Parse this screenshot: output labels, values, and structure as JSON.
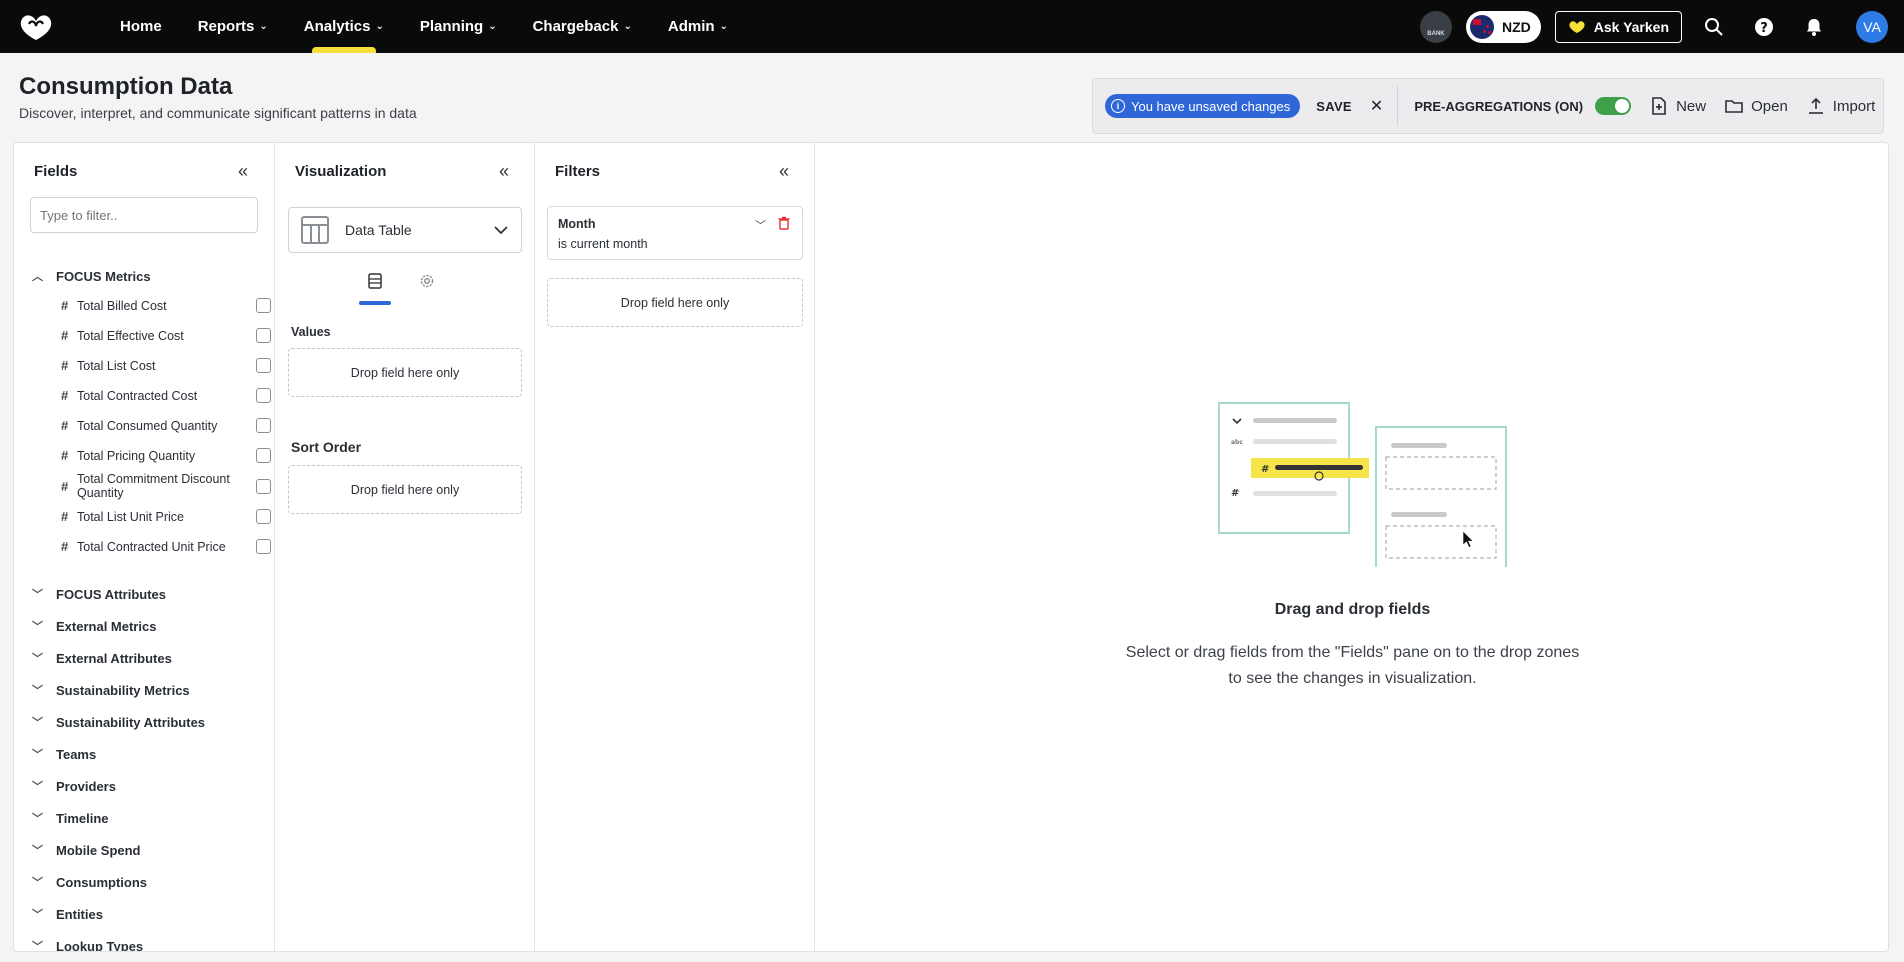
{
  "nav": {
    "items": [
      {
        "label": "Home",
        "has_menu": false
      },
      {
        "label": "Reports",
        "has_menu": true
      },
      {
        "label": "Analytics",
        "has_menu": true,
        "active": true
      },
      {
        "label": "Planning",
        "has_menu": true
      },
      {
        "label": "Chargeback",
        "has_menu": true
      },
      {
        "label": "Admin",
        "has_menu": true
      }
    ],
    "bank_label": "BANK",
    "currency": "NZD",
    "ask_label": "Ask Yarken",
    "avatar_initials": "VA",
    "accent_color": "#f5e03a"
  },
  "page": {
    "title": "Consumption Data",
    "subtitle": "Discover, interpret, and communicate significant patterns in data"
  },
  "actionbar": {
    "unsaved_label": "You have unsaved changes",
    "save_label": "SAVE",
    "close_label": "✕",
    "preagg_label": "PRE-AGGREGATIONS (ON)",
    "preagg_on": true,
    "new_label": "New",
    "open_label": "Open",
    "import_label": "Import"
  },
  "fields_pane": {
    "title": "Fields",
    "filter_placeholder": "Type to filter..",
    "expanded_group": "FOCUS Metrics",
    "metrics": [
      "Total Billed Cost",
      "Total Effective Cost",
      "Total List Cost",
      "Total Contracted Cost",
      "Total Consumed Quantity",
      "Total Pricing Quantity",
      "Total Commitment Discount Quantity",
      "Total List Unit Price",
      "Total Contracted Unit Price"
    ],
    "groups": [
      "FOCUS Attributes",
      "External Metrics",
      "External Attributes",
      "Sustainability Metrics",
      "Sustainability Attributes",
      "Teams",
      "Providers",
      "Timeline",
      "Mobile Spend",
      "Consumptions",
      "Entities",
      "Lookup Types"
    ]
  },
  "viz_pane": {
    "title": "Visualization",
    "selected_type": "Data Table",
    "values_label": "Values",
    "values_drop": "Drop field here only",
    "sort_label": "Sort Order",
    "sort_drop": "Drop field here only"
  },
  "filters_pane": {
    "title": "Filters",
    "filter_field": "Month",
    "filter_value": "is current month",
    "drop": "Drop field here only"
  },
  "empty_state": {
    "title": "Drag and drop fields",
    "line1": "Select or drag fields from the \"Fields\" pane on to the drop zones",
    "line2": "to see the changes in visualization."
  }
}
